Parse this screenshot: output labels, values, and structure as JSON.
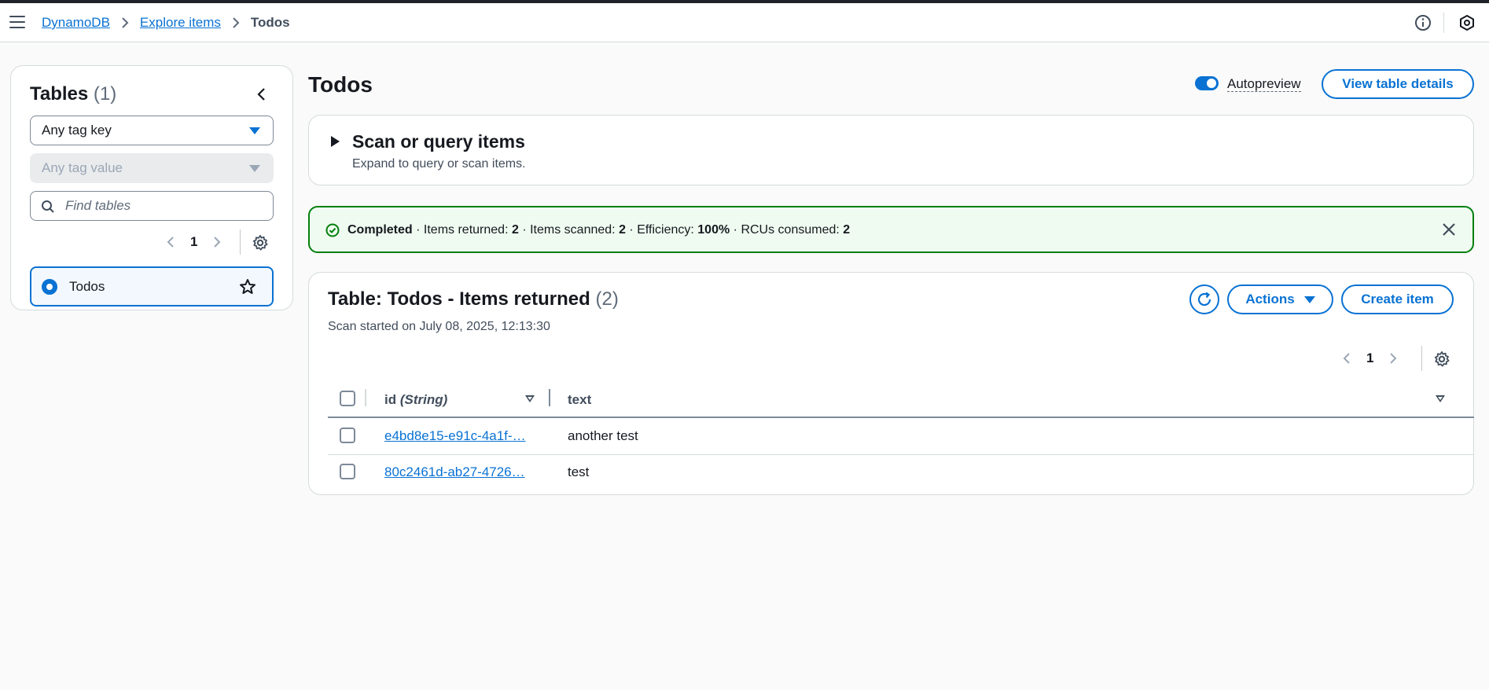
{
  "breadcrumbs": {
    "items": [
      "DynamoDB",
      "Explore items"
    ],
    "current": "Todos"
  },
  "sidebar": {
    "title": "Tables",
    "count": "(1)",
    "tag_key": "Any tag key",
    "tag_value": "Any tag value",
    "search_placeholder": "Find tables",
    "page": "1",
    "tables": [
      {
        "name": "Todos",
        "selected": true
      }
    ]
  },
  "main": {
    "title": "Todos",
    "autopreview_label": "Autopreview",
    "autopreview_on": true,
    "view_details_label": "View table details"
  },
  "scan": {
    "title": "Scan or query items",
    "subtitle": "Expand to query or scan items."
  },
  "alert": {
    "status": "Completed",
    "items_returned_label": "Items returned:",
    "items_returned": "2",
    "items_scanned_label": "Items scanned:",
    "items_scanned": "2",
    "efficiency_label": "Efficiency:",
    "efficiency": "100%",
    "rcus_label": "RCUs consumed:",
    "rcus": "2",
    "sep": "·"
  },
  "results": {
    "title": "Table: Todos - Items returned",
    "count": "(2)",
    "subtitle": "Scan started on July 08, 2025, 12:13:30",
    "actions_label": "Actions",
    "create_label": "Create item",
    "page": "1",
    "columns": {
      "id": "id",
      "id_type": "(String)",
      "text": "text"
    },
    "rows": [
      {
        "id": "e4bd8e15-e91c-4a1f-…",
        "text": "another test"
      },
      {
        "id": "80c2461d-ab27-4726…",
        "text": "test"
      }
    ]
  },
  "colors": {
    "accent": "#0972d3",
    "success": "#037f0c",
    "success_bg": "#effbf0"
  }
}
